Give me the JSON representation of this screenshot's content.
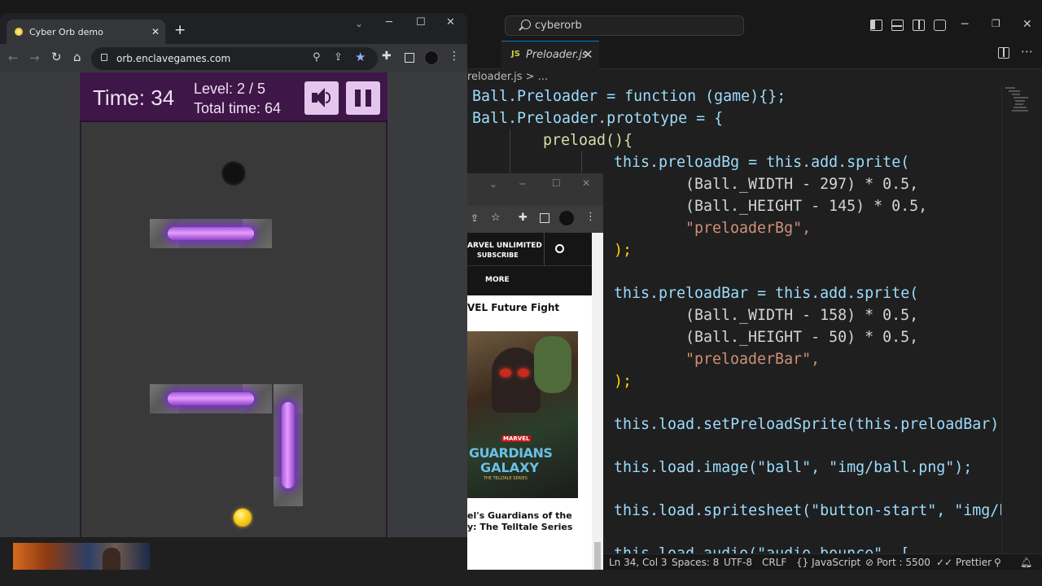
{
  "vscode": {
    "search": "cyberorb",
    "tab": {
      "lang": "JS",
      "name": "Preloader.js",
      "close": "✕"
    },
    "breadcrumb": "reloader.js > ...",
    "status": {
      "position": "Ln 34, Col 3",
      "spaces": "Spaces: 8",
      "encoding": "UTF-8",
      "eol": "CRLF",
      "language": "{} JavaScript",
      "port": "⊘ Port : 5500",
      "prettier": "✓✓ Prettier"
    },
    "code": [
      "Ball.Preloader = function (game){};",
      "Ball.Preloader.prototype = {",
      "preload(){",
      "this.preloadBg = this.add.sprite(",
      "(Ball._WIDTH - 297) * 0.5,",
      "(Ball._HEIGHT - 145) * 0.5,",
      "\"preloaderBg\",",
      ");",
      "",
      "this.preloadBar = this.add.sprite(",
      "(Ball._WIDTH - 158) * 0.5,",
      "(Ball._HEIGHT - 50) * 0.5,",
      "\"preloaderBar\",",
      ");",
      "",
      "this.load.setPreloadSprite(this.preloadBar);",
      "",
      "this.load.image(\"ball\", \"img/ball.png\");",
      "",
      "this.load.spritesheet(\"button-start\", \"img/b",
      "",
      "this.load.audio(\"audio-bounce\", ["
    ]
  },
  "chrome": {
    "tab_title": "Cyber Orb demo",
    "url": "orb.enclavegames.com",
    "new_tab": "+",
    "tab_close": "✕"
  },
  "game": {
    "time_label": "Time: 34",
    "level_label": "Level: 2 / 5",
    "total_label": "Total time: 64"
  },
  "marvel": {
    "promo_line1": "ARVEL UNLIMITED",
    "promo_line2": "SUBSCRIBE",
    "nav_more": "MORE",
    "heading": "VEL Future Fight",
    "poster_brand": "MARVEL",
    "poster_title1": "GUARDIANS",
    "poster_title2": "GALAXY",
    "poster_sub": "THE TELLTALE SERIES",
    "caption_line1": "el's Guardians of the",
    "caption_line2": "y: The Telltale Series"
  },
  "colors": {
    "accent": "#0078d4",
    "hud": "#3e1748",
    "energy": "#e59cff"
  }
}
